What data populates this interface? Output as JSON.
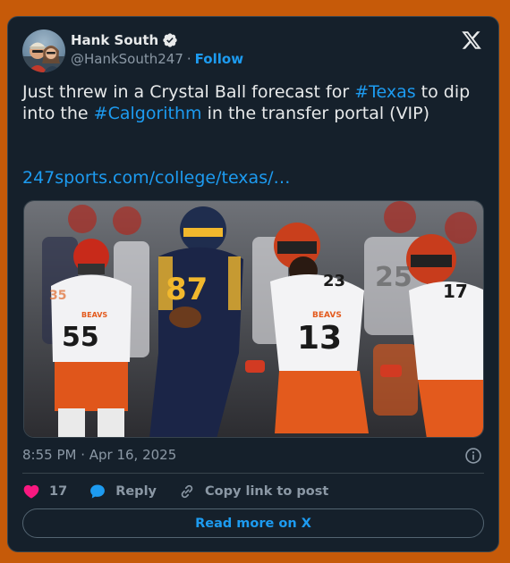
{
  "author": {
    "display_name": "Hank South",
    "handle": "@HankSouth247",
    "separator": "·",
    "follow_label": "Follow"
  },
  "tweet": {
    "text_1": "Just threw in a Crystal Ball forecast for ",
    "hashtag_1": "#Texas",
    "text_2": " to dip into the ",
    "hashtag_2": "#Calgorithm",
    "text_3": " in the transfer portal (VIP)",
    "link": "247sports.com/college/texas/…"
  },
  "photo": {
    "jersey_numbers": [
      "87",
      "23",
      "13",
      "17",
      "55",
      "25",
      "35"
    ],
    "jersey_text": "BEAVS"
  },
  "meta": {
    "timestamp": "8:55 PM · Apr 16, 2025"
  },
  "actions": {
    "like_count": "17",
    "reply_label": "Reply",
    "copy_label": "Copy link to post"
  },
  "cta": {
    "read_more": "Read more on X"
  },
  "colors": {
    "background": "#c65a09",
    "card": "#15202b",
    "accent": "#1d9bf0",
    "like": "#f91880"
  }
}
